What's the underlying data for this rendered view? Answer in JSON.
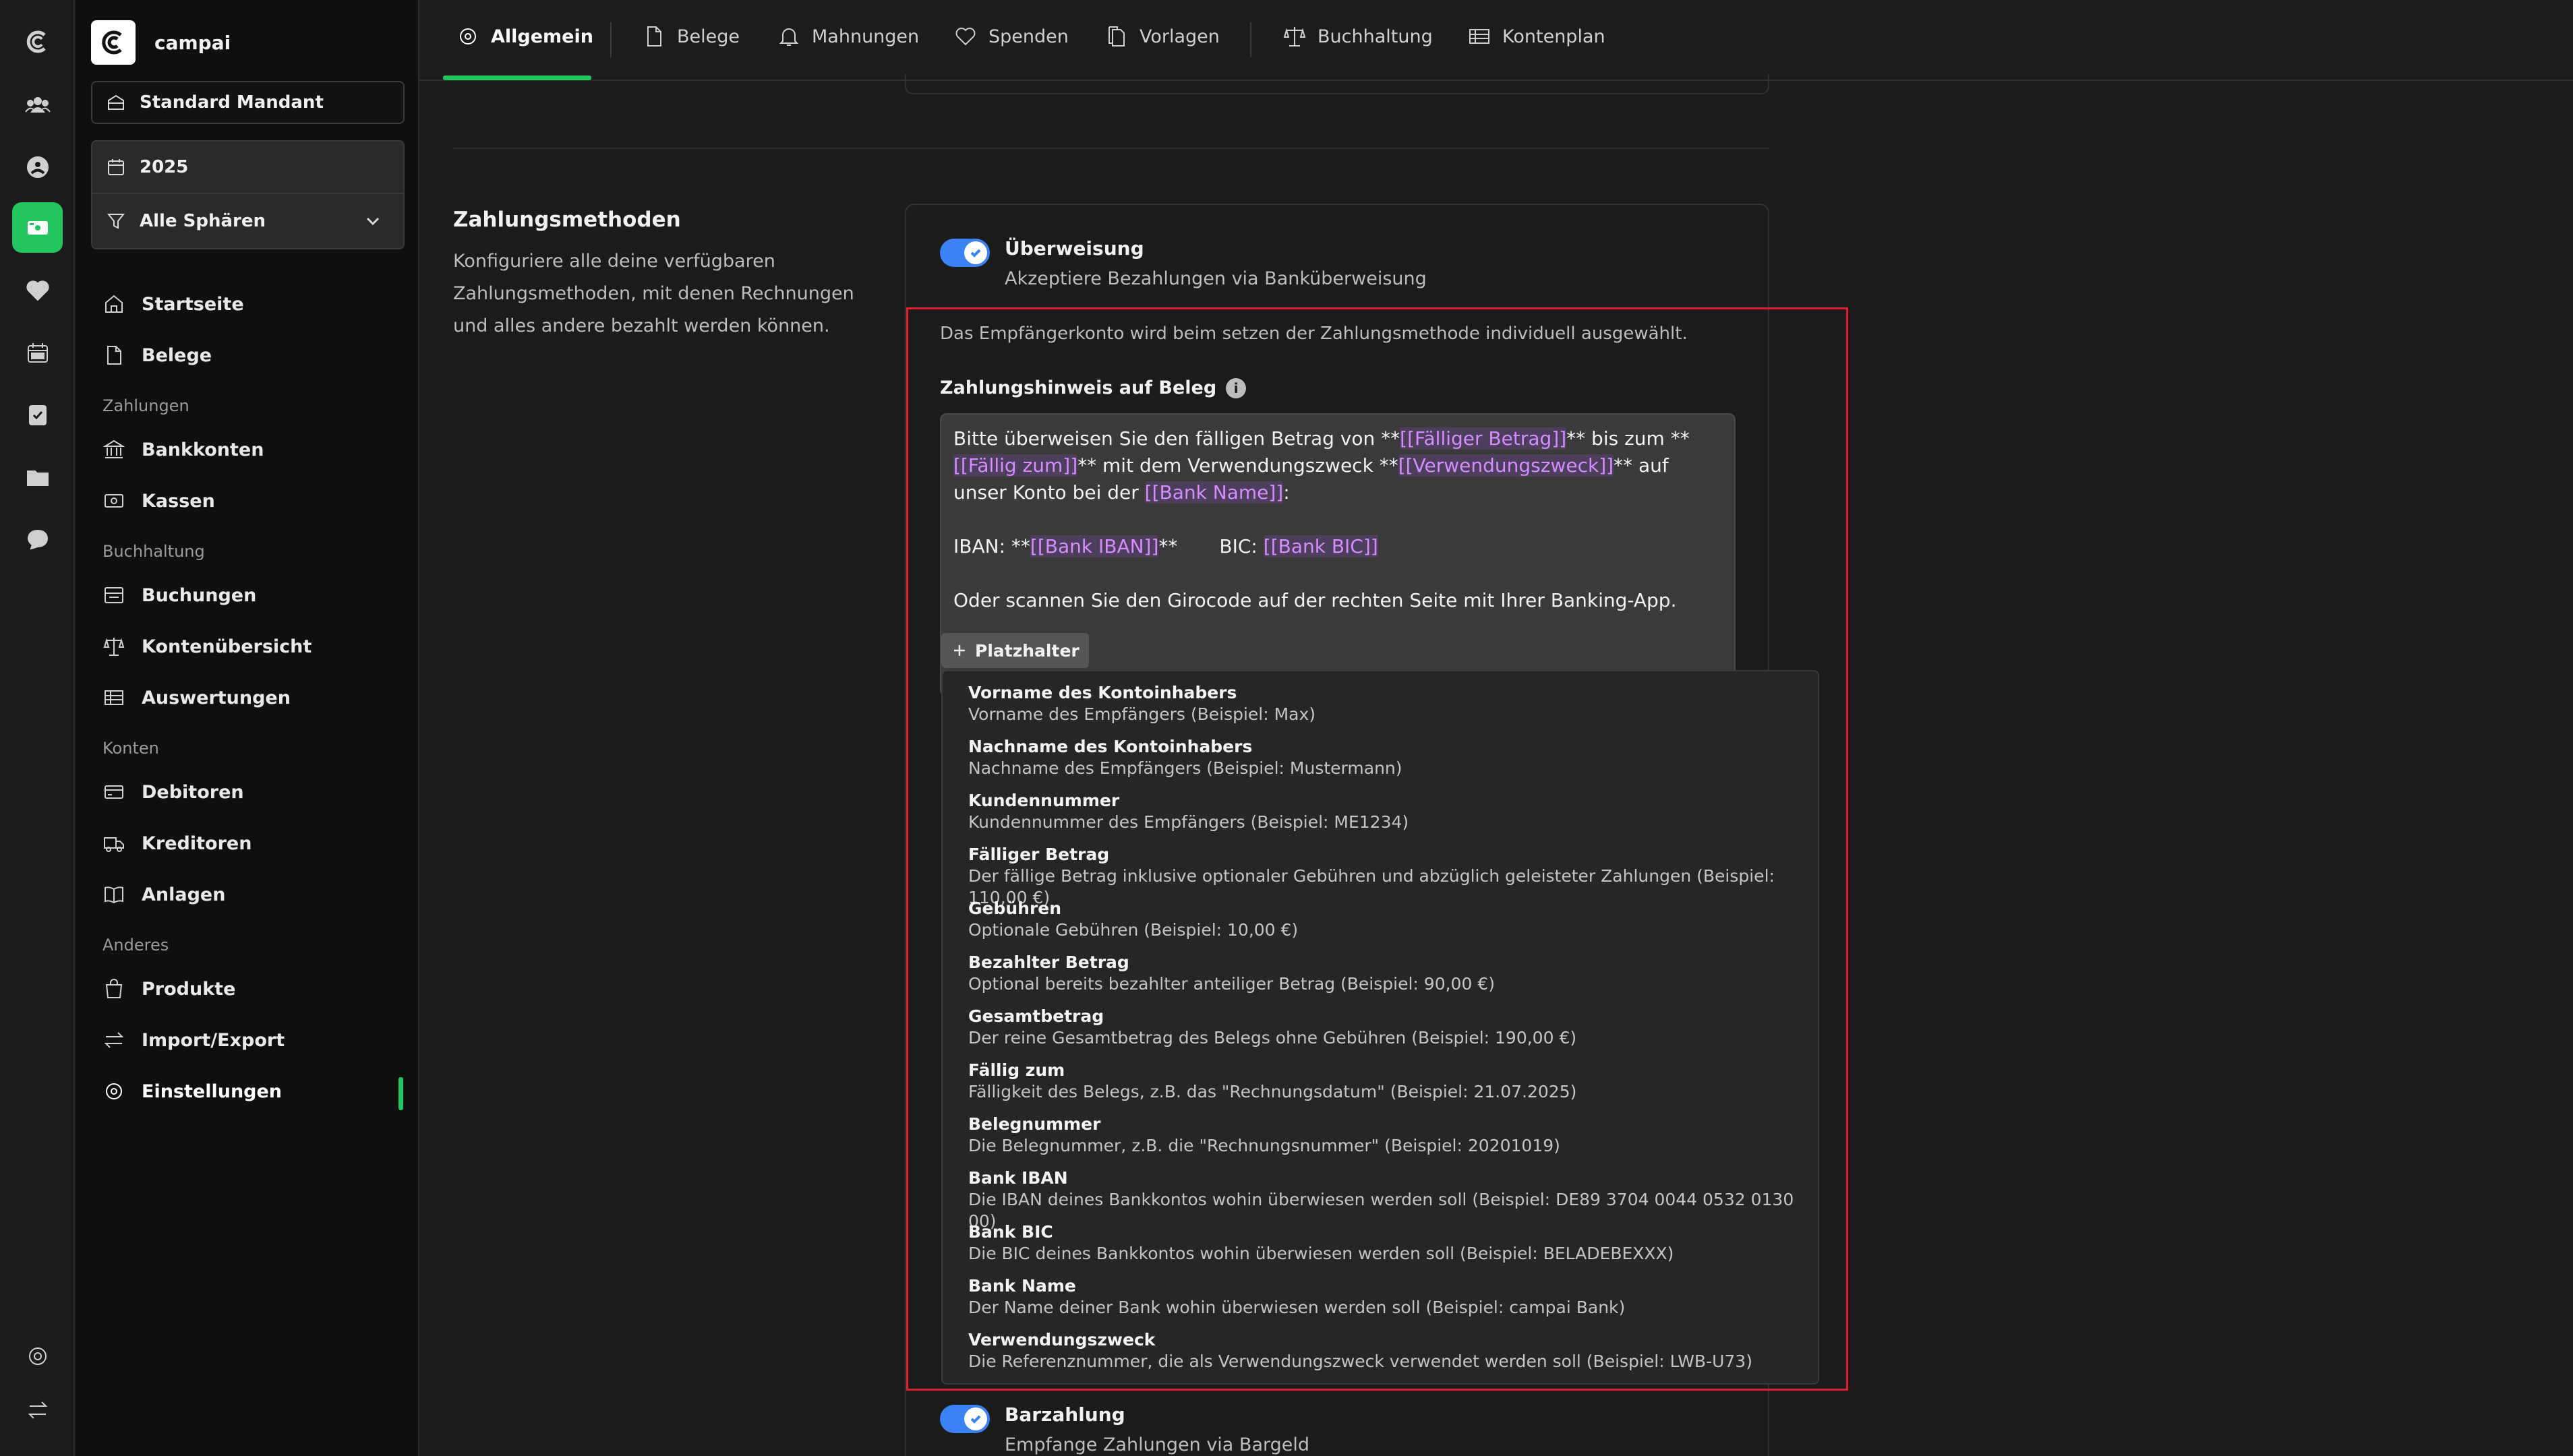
{
  "sidebar": {
    "brand_name": "campai",
    "mandant": "Standard Mandant",
    "year": "2025",
    "sphere_filter": "Alle Sphären",
    "items_top": [
      {
        "label": "Startseite"
      },
      {
        "label": "Belege"
      }
    ],
    "group_zahlungen": "Zahlungen",
    "items_zahlungen": [
      {
        "label": "Bankkonten"
      },
      {
        "label": "Kassen"
      }
    ],
    "group_buchhaltung": "Buchhaltung",
    "items_buchhaltung": [
      {
        "label": "Buchungen"
      },
      {
        "label": "Kontenübersicht"
      },
      {
        "label": "Auswertungen"
      }
    ],
    "group_konten": "Konten",
    "items_konten": [
      {
        "label": "Debitoren"
      },
      {
        "label": "Kreditoren"
      },
      {
        "label": "Anlagen"
      }
    ],
    "group_anderes": "Anderes",
    "items_anderes": [
      {
        "label": "Produkte"
      },
      {
        "label": "Import/Export"
      },
      {
        "label": "Einstellungen"
      }
    ],
    "active_item": "Einstellungen"
  },
  "tabs": [
    {
      "label": "Allgemein",
      "active": true
    },
    {
      "label": "Belege"
    },
    {
      "label": "Mahnungen"
    },
    {
      "label": "Spenden"
    },
    {
      "label": "Vorlagen"
    },
    {
      "label": "Buchhaltung"
    },
    {
      "label": "Kontenplan"
    }
  ],
  "section": {
    "title": "Zahlungsmethoden",
    "description": "Konfiguriere alle deine verfügbaren Zahlungsmethoden, mit denen Rechnungen und alles andere bezahlt werden können."
  },
  "methods": {
    "transfer": {
      "title": "Überweisung",
      "subtitle": "Akzeptiere Bezahlungen via Banküberweisung",
      "enabled": true
    },
    "cash": {
      "title": "Barzahlung",
      "subtitle": "Empfange Zahlungen via Bargeld",
      "enabled": true
    }
  },
  "transfer_settings": {
    "info_text": "Das Empfängerkonto wird beim setzen der Zahlungsmethode individuell ausgewählt.",
    "field_label": "Zahlungshinweis auf Beleg",
    "editor": {
      "p1_a": "Bitte überweisen Sie den fälligen Betrag von **",
      "p1_ph1": "[[Fälliger Betrag]]",
      "p1_b": "** bis zum **",
      "p1_ph2": "[[Fällig zum]]",
      "p1_c": "** mit dem Verwendungszweck **",
      "p1_ph3": "[[Verwendungszweck]]",
      "p1_d": "** auf unser Konto bei der ",
      "p1_ph4": "[[Bank Name]]",
      "p1_e": ":",
      "p2_a": "IBAN: **",
      "p2_ph1": "[[Bank IBAN]]",
      "p2_b": "**",
      "p2_c": "BIC: ",
      "p2_ph2": "[[Bank BIC]]",
      "p3": "Oder scannen Sie den Girocode auf der rechten Seite mit Ihrer Banking-App."
    },
    "placeholder_button": "Platzhalter"
  },
  "placeholder_menu": [
    {
      "title": "Vorname des Kontoinhabers",
      "desc": "Vorname des Empfängers (Beispiel: Max)"
    },
    {
      "title": "Nachname des Kontoinhabers",
      "desc": "Nachname des Empfängers (Beispiel: Mustermann)"
    },
    {
      "title": "Kundennummer",
      "desc": "Kundennummer des Empfängers (Beispiel: ME1234)"
    },
    {
      "title": "Fälliger Betrag",
      "desc": "Der fällige Betrag inklusive optionaler Gebühren und abzüglich geleisteter Zahlungen (Beispiel: 110,00 €)"
    },
    {
      "title": "Gebühren",
      "desc": "Optionale Gebühren (Beispiel: 10,00 €)"
    },
    {
      "title": "Bezahlter Betrag",
      "desc": "Optional bereits bezahlter anteiliger Betrag (Beispiel: 90,00 €)"
    },
    {
      "title": "Gesamtbetrag",
      "desc": "Der reine Gesamtbetrag des Belegs ohne Gebühren (Beispiel: 190,00 €)"
    },
    {
      "title": "Fällig zum",
      "desc": "Fälligkeit des Belegs, z.B. das \"Rechnungsdatum\" (Beispiel: 21.07.2025)"
    },
    {
      "title": "Belegnummer",
      "desc": "Die Belegnummer, z.B. die \"Rechnungsnummer\" (Beispiel: 20201019)"
    },
    {
      "title": "Bank IBAN",
      "desc": "Die IBAN deines Bankkontos wohin überwiesen werden soll (Beispiel: DE89 3704 0044 0532 0130 00)"
    },
    {
      "title": "Bank BIC",
      "desc": "Die BIC deines Bankkontos wohin überwiesen werden soll (Beispiel: BELADEBEXXX)"
    },
    {
      "title": "Bank Name",
      "desc": "Der Name deiner Bank wohin überwiesen werden soll (Beispiel: campai Bank)"
    },
    {
      "title": "Verwendungszweck",
      "desc": "Die Referenznummer, die als Verwendungszweck verwendet werden soll (Beispiel: LWB-U73)"
    }
  ],
  "colors": {
    "accent_green": "#22c55e",
    "toggle_blue": "#3b82f6",
    "placeholder_purple": "#d68cff",
    "highlight_red": "#e11d2e"
  }
}
